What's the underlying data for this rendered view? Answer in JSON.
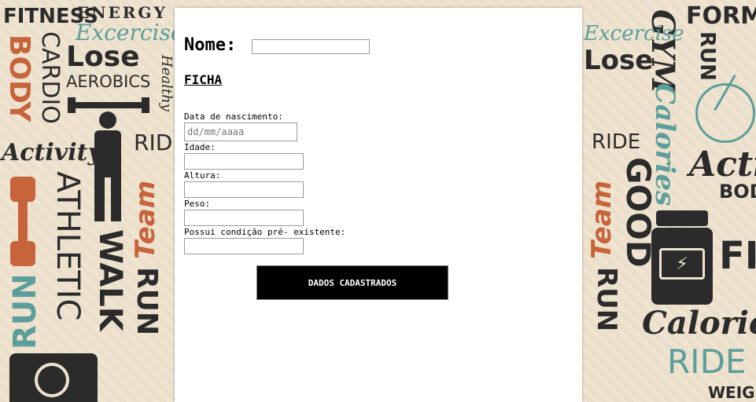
{
  "form": {
    "name_label": "Nome:",
    "name_value": "",
    "section_title": "FICHA",
    "fields": [
      {
        "label": "Data de nascimento:",
        "placeholder": "dd/mm/aaaa"
      },
      {
        "label": "Idade:",
        "value": ""
      },
      {
        "label": "Altura:",
        "value": ""
      },
      {
        "label": "Peso:",
        "value": ""
      },
      {
        "label": "Possui condição pré- existente:",
        "value": ""
      }
    ],
    "submit_label": "DADOS CADASTRADOS"
  },
  "background": {
    "words": [
      "FITNESS",
      "ENERGY",
      "Excercise",
      "Lose",
      "AEROBICS",
      "BODY",
      "CARDIO",
      "Healthy",
      "Activity",
      "RIDE",
      "ATHLETIC",
      "WALK",
      "Team",
      "RUN",
      "FORM",
      "GOOD",
      "Calories",
      "Activity",
      "BODY",
      "FIT",
      "GYM",
      "RIDE",
      "WEIGH"
    ],
    "colors": {
      "dark": "#2b2b2b",
      "orange": "#c8643c",
      "teal": "#5b9e9b",
      "paper": "#efe3cf"
    }
  }
}
